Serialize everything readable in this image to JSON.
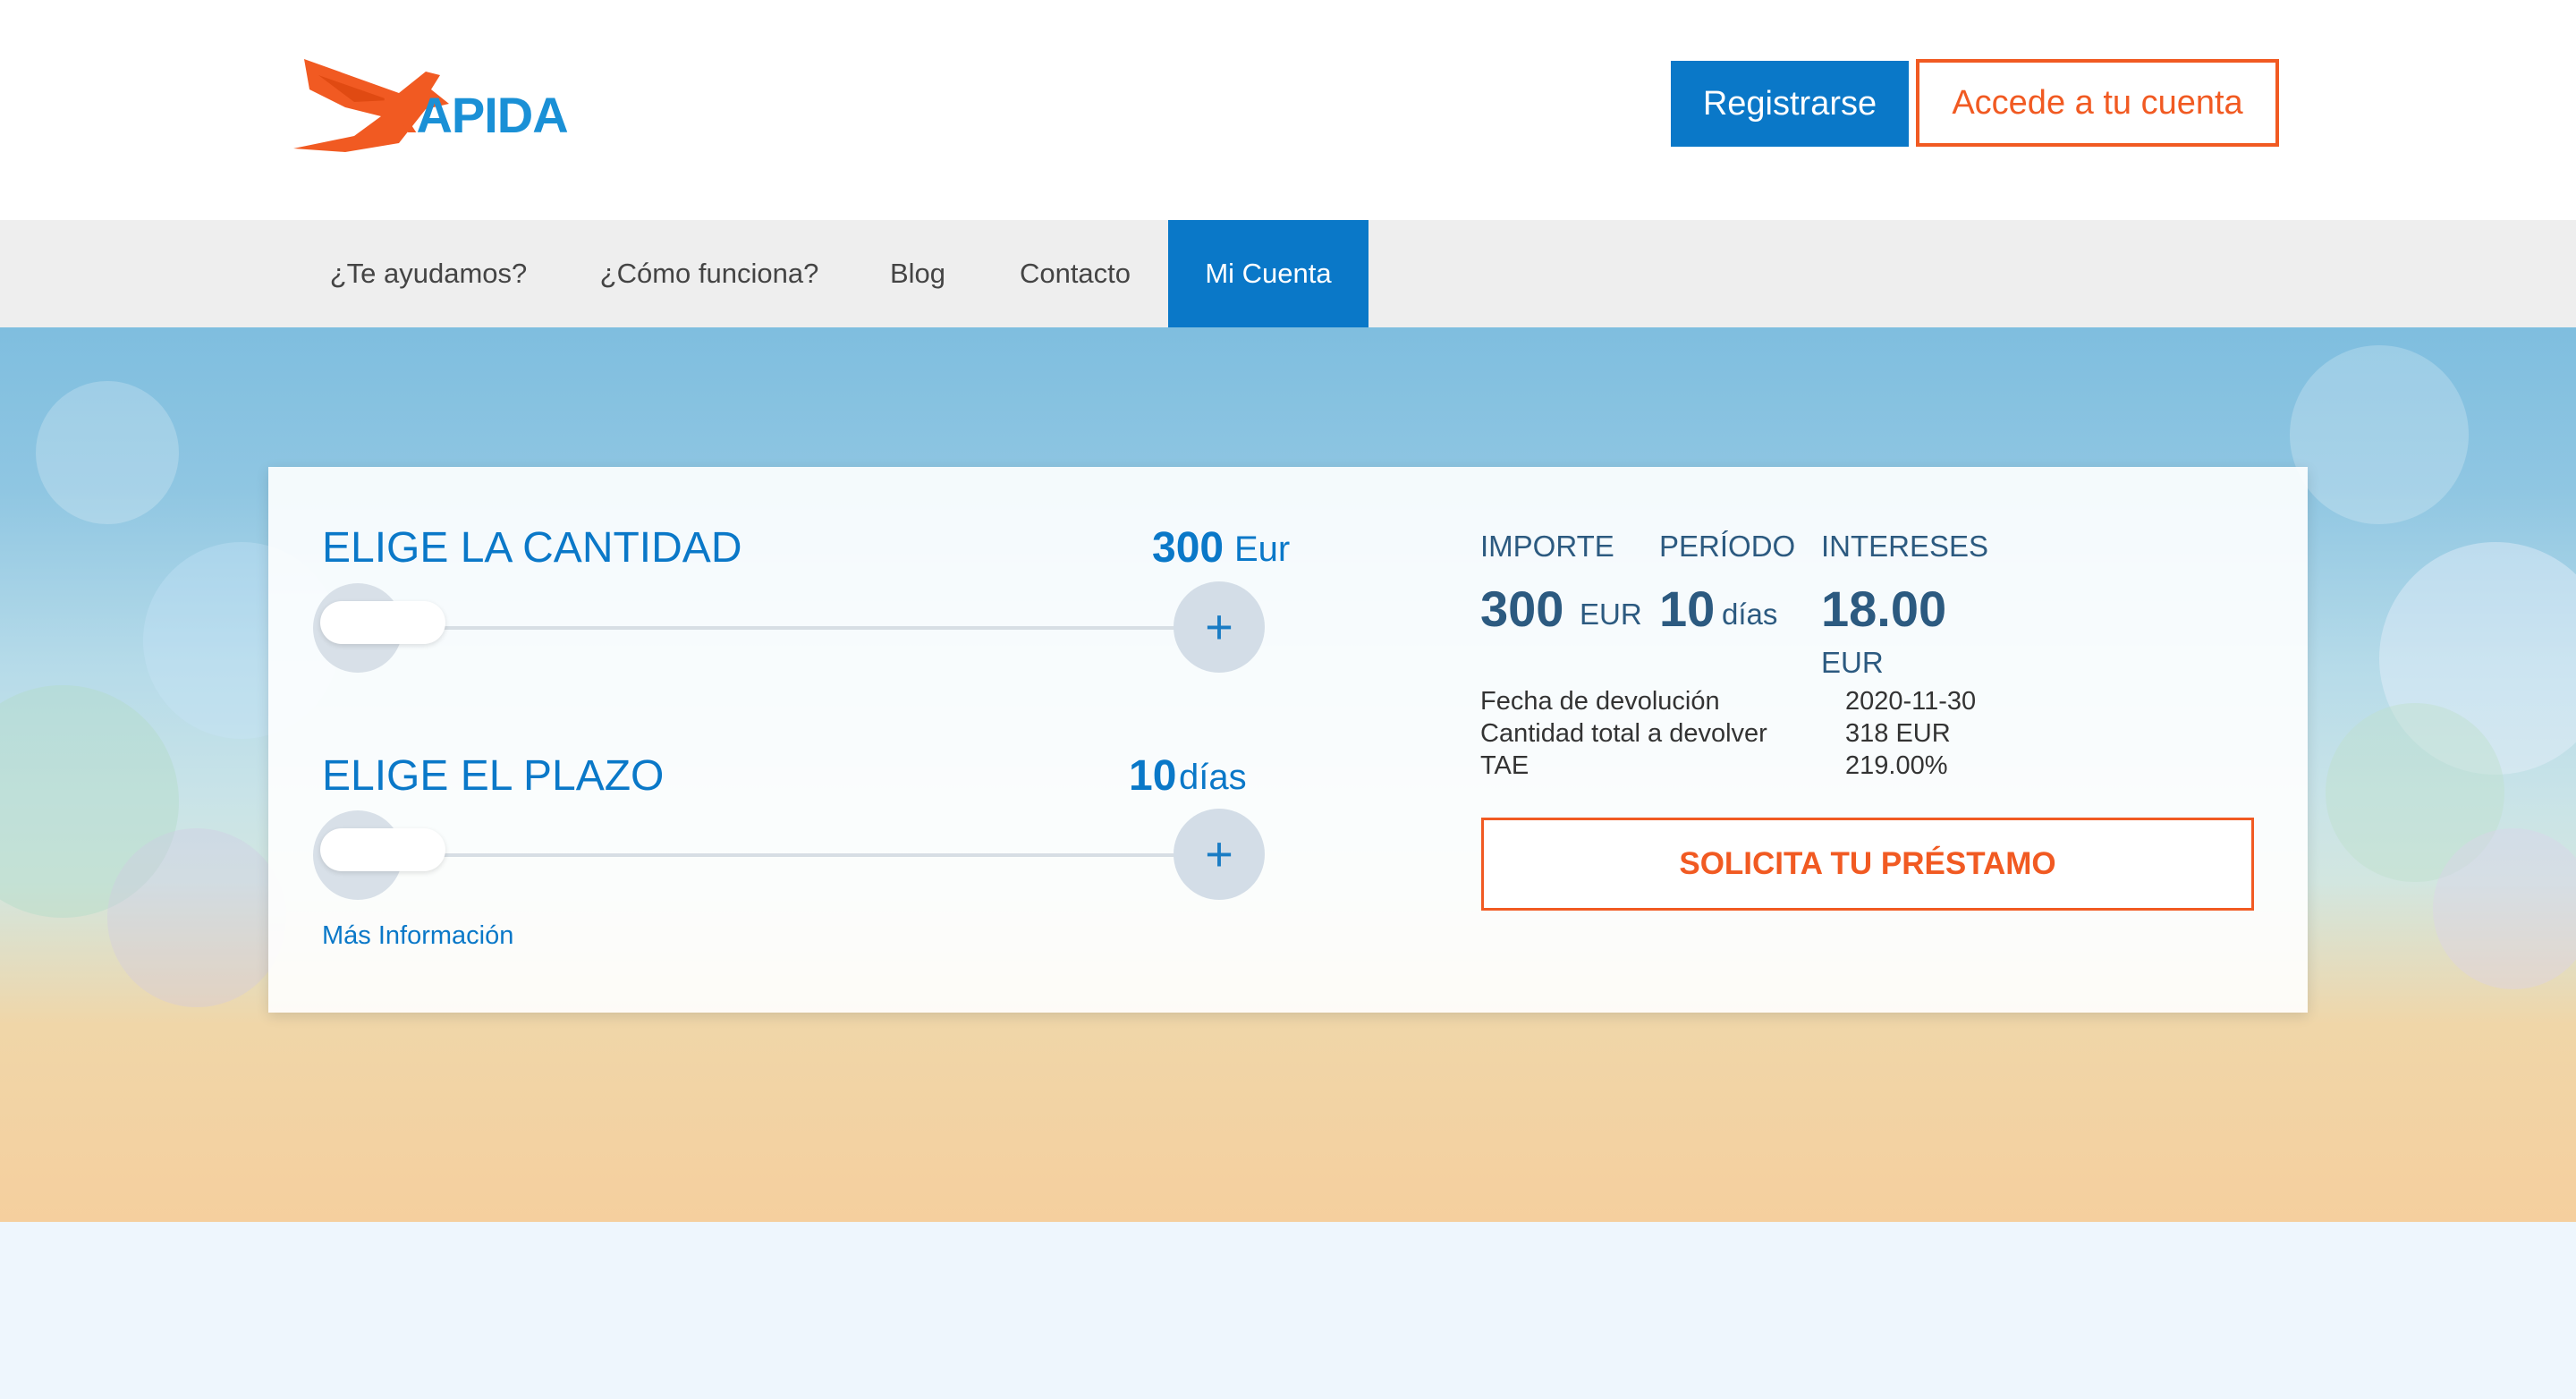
{
  "brand": {
    "logo_text_first": "R",
    "logo_text_rest": "APIDA",
    "color_orange": "#f15a22",
    "color_blue": "#0a78c8"
  },
  "header": {
    "register_label": "Registrarse",
    "login_label": "Accede a tu cuenta"
  },
  "nav": {
    "items": [
      {
        "label": "¿Te ayudamos?"
      },
      {
        "label": "¿Cómo funciona?"
      },
      {
        "label": "Blog"
      },
      {
        "label": "Contacto"
      },
      {
        "label": "Mi Cuenta",
        "active": true
      }
    ]
  },
  "calculator": {
    "amount": {
      "label": "ELIGE LA CANTIDAD",
      "value": "300",
      "unit": "Eur",
      "slider_fraction": 0
    },
    "term": {
      "label": "ELIGE EL PLAZO",
      "value": "10",
      "unit": "días",
      "slider_fraction": 0
    },
    "plus_symbol": "+",
    "more_info": "Más Información"
  },
  "summary": {
    "importe": {
      "label": "IMPORTE",
      "value": "300",
      "unit": "EUR"
    },
    "periodo": {
      "label": "PERÍODO",
      "value": "10",
      "unit": "días"
    },
    "intereses": {
      "label": "INTERESES",
      "value": "18.00",
      "unit": "EUR"
    },
    "details": [
      {
        "label": "Fecha de devolución",
        "value": "2020-11-30"
      },
      {
        "label": "Cantidad total a devolver",
        "value": "318 EUR"
      },
      {
        "label": "TAE",
        "value": "219.00%"
      }
    ],
    "cta_label": "SOLICITA TU PRÉSTAMO"
  }
}
